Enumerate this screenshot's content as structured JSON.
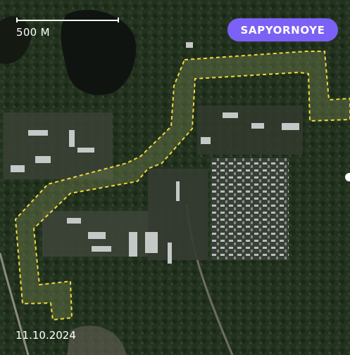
{
  "scale_bar": {
    "label": "500 M"
  },
  "location": {
    "label": "SAPYORNOYE"
  },
  "capture_date": "11.10.2024",
  "colors": {
    "badge": "#7b61f5",
    "boundary": "#f2d63a",
    "text": "#ffffff"
  },
  "icons": {
    "edge_marker": "white-dot"
  }
}
